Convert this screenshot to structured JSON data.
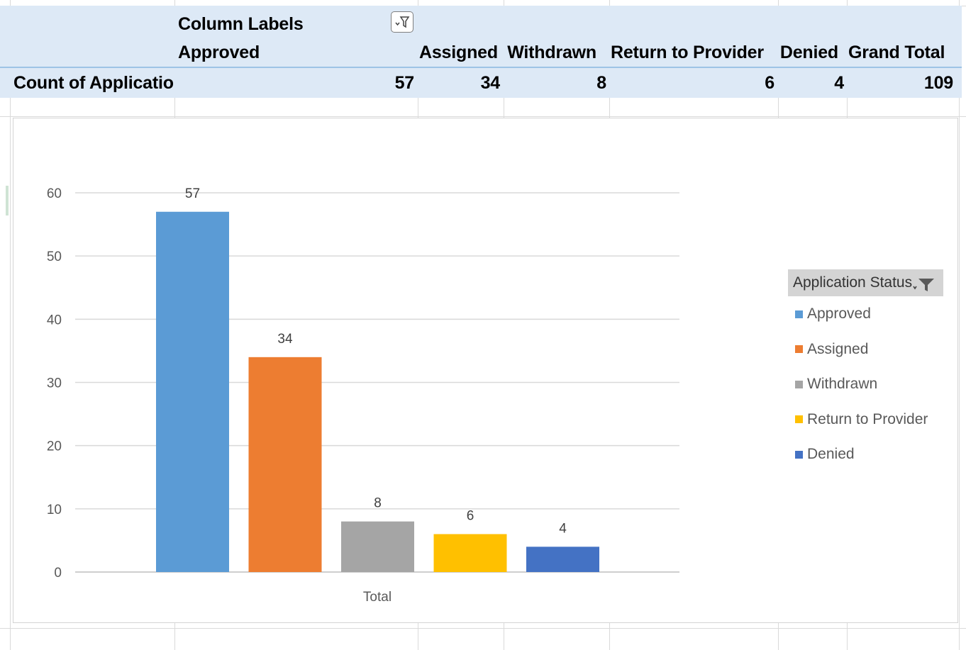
{
  "pivot": {
    "column_labels_header": "Column Labels",
    "row_header": "Count of Application",
    "columns": [
      "Approved",
      "Assigned",
      "Withdrawn",
      "Return to Provider",
      "Denied",
      "Grand Total"
    ],
    "values": [
      "57",
      "34",
      "8",
      "6",
      "4",
      "109"
    ]
  },
  "chart": {
    "legend_title": "Application Status",
    "legend": [
      "Approved",
      "Assigned",
      "Withdrawn",
      "Return to Provider",
      "Denied"
    ],
    "colors": [
      "#5b9bd5",
      "#ed7d31",
      "#a5a5a5",
      "#ffc000",
      "#4472c4"
    ]
  },
  "chart_data": {
    "type": "bar",
    "categories": [
      "Total"
    ],
    "series": [
      {
        "name": "Approved",
        "values": [
          57
        ]
      },
      {
        "name": "Assigned",
        "values": [
          34
        ]
      },
      {
        "name": "Withdrawn",
        "values": [
          8
        ]
      },
      {
        "name": "Return to Provider",
        "values": [
          6
        ]
      },
      {
        "name": "Denied",
        "values": [
          4
        ]
      }
    ],
    "yticks": [
      0,
      10,
      20,
      30,
      40,
      50,
      60
    ],
    "ylim": [
      0,
      60
    ],
    "xlabel": "Total",
    "title": "",
    "grid": true,
    "legend_position": "right",
    "data_labels": true
  }
}
